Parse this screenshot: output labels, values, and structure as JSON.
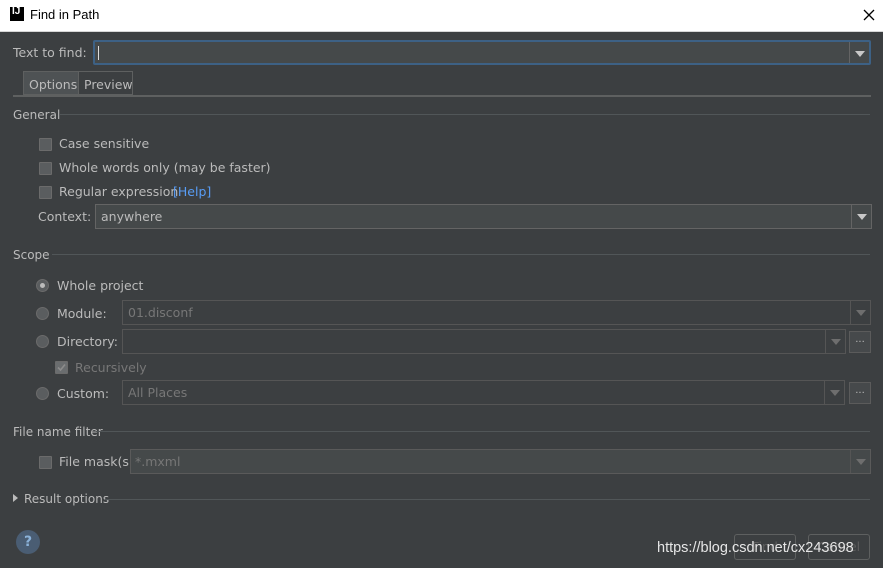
{
  "window": {
    "title": "Find in Path",
    "icon": "intellij-icon"
  },
  "text_to_find": {
    "label": "Text to find:",
    "value": ""
  },
  "tabs": [
    {
      "label": "Options",
      "active": true
    },
    {
      "label": "Preview",
      "active": false
    }
  ],
  "general": {
    "header": "General",
    "case_sensitive": "Case sensitive",
    "whole_words": "Whole words only (may be faster)",
    "regex": "Regular expression",
    "regex_help": "[Help]",
    "context_label": "Context:",
    "context_value": "anywhere"
  },
  "scope": {
    "header": "Scope",
    "whole_project": "Whole project",
    "module_label": "Module:",
    "module_value": "01.disconf",
    "directory_label": "Directory:",
    "directory_value": "",
    "recursively": "Recursively",
    "custom_label": "Custom:",
    "custom_value": "All Places",
    "browse": "..."
  },
  "file_filter": {
    "header": "File name filter",
    "mask_label": "File mask(s)",
    "mask_value": "*.mxml"
  },
  "result_options": {
    "label": "Result options"
  },
  "buttons": {
    "help": "?",
    "find": "Find",
    "cancel": "Cancel"
  },
  "watermark": "https://blog.csdn.net/cx243698",
  "colors": {
    "background": "#3c3f41",
    "focus": "#3d6185",
    "link": "#589df6"
  }
}
